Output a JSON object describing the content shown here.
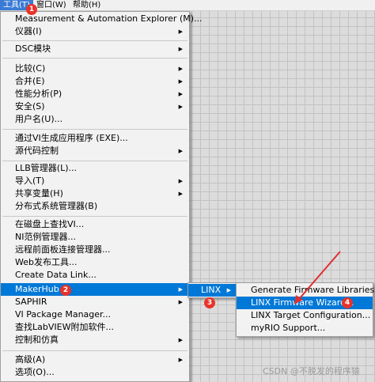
{
  "menubar": {
    "tools": "工具(T)",
    "window": "窗口(W)",
    "help": "帮助(H)"
  },
  "tools_menu": [
    "Measurement & Automation Explorer (M)...",
    "仪器(I)",
    "DSC模块",
    "比较(C)",
    "合并(E)",
    "性能分析(P)",
    "安全(S)",
    "用户名(U)...",
    "通过VI生成应用程序 (EXE)...",
    "源代码控制",
    "LLB管理器(L)...",
    "导入(T)",
    "共享变量(H)",
    "分布式系统管理器(B)",
    "在磁盘上查找VI...",
    "NI范例管理器...",
    "远程前面板连接管理器...",
    "Web发布工具...",
    "Create Data Link...",
    "MakerHub",
    "SAPHIR",
    "VI Package Manager...",
    "查找LabVIEW附加软件...",
    "控制和仿真",
    "高级(A)",
    "选项(O)..."
  ],
  "linx_menu": {
    "label": "LINX"
  },
  "linx_submenu": [
    "Generate Firmware Libraries...",
    "LINX Firmware Wizard...",
    "LINX Target Configuration...",
    "myRIO Support..."
  ],
  "badges": [
    "1",
    "2",
    "3",
    "4"
  ],
  "watermark": "CSDN @不脱发的程序猿",
  "colors": {
    "highlight": "#0078d7",
    "badge": "#e8332a",
    "annotation_arrow": "#e03030"
  }
}
